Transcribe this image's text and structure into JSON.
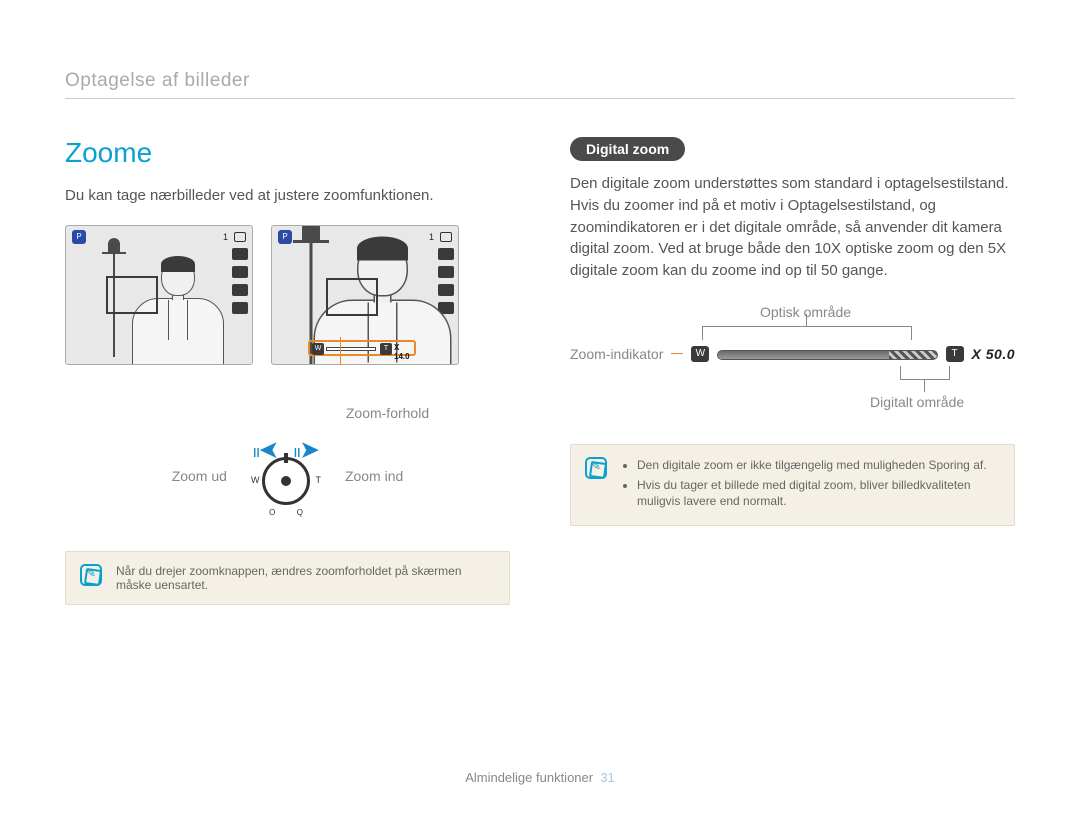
{
  "header": {
    "breadcrumb": "Optagelse af billeder"
  },
  "left": {
    "title": "Zoome",
    "intro": "Du kan tage nærbilleder ved at justere zoomfunktionen.",
    "lcd": {
      "mode_icon": "P",
      "shots_remaining": "1",
      "w_label": "W",
      "t_label": "T",
      "zoom_value": "X 14.0"
    },
    "labels": {
      "zoom_ratio": "Zoom-forhold",
      "zoom_out": "Zoom ud",
      "zoom_in": "Zoom ind",
      "dial_w": "W",
      "dial_t": "T",
      "dial_o": "O",
      "dial_q": "Q"
    },
    "note": "Når du drejer zoomknappen, ændres zoomforholdet på skærmen måske uensartet."
  },
  "right": {
    "pill": "Digital zoom",
    "body": "Den digitale zoom understøttes som standard i optagelsestilstand. Hvis du zoomer ind på et motiv i Optagelsestilstand, og zoomindikatoren er i det digitale område, så anvender dit kamera digital zoom. Ved at bruge både den 10X optiske zoom og den 5X digitale zoom kan du zoome ind op til 50 gange.",
    "indicator": {
      "optical_label": "Optisk område",
      "zoom_indicator_label": "Zoom-indikator",
      "digital_label": "Digitalt område",
      "w": "W",
      "t": "T",
      "value": "X 50.0"
    },
    "notes": [
      "Den digitale zoom er ikke tilgængelig med muligheden Sporing af.",
      "Hvis du tager et billede med digital zoom, bliver billedkvaliteten muligvis lavere end normalt."
    ]
  },
  "footer": {
    "section": "Almindelige funktioner",
    "page": "31"
  }
}
